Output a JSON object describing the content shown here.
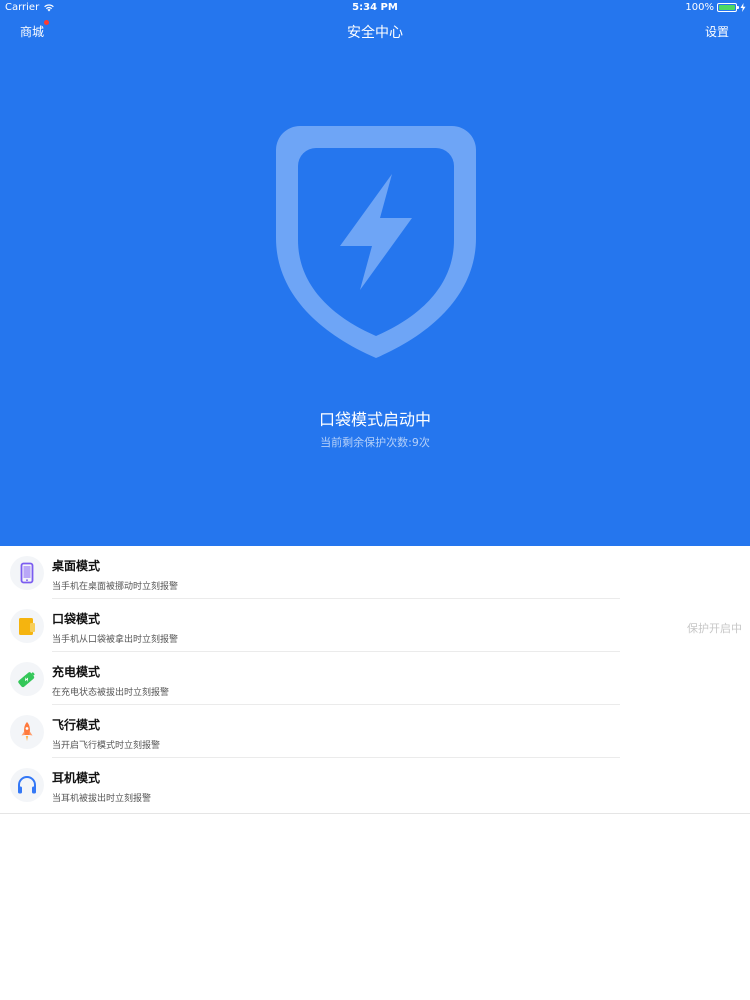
{
  "status_bar": {
    "carrier": "Carrier",
    "time": "5:34 PM",
    "battery": "100%",
    "battery_level": 1.0
  },
  "nav": {
    "left_label": "商城",
    "title": "安全中心",
    "right_label": "设置"
  },
  "hero": {
    "icon": "shield-lightning-icon",
    "mode_title": "口袋模式启动中",
    "remaining": "当前剩余保护次数:9次"
  },
  "modes": [
    {
      "title": "桌面模式",
      "desc": "当手机在桌面被挪动时立刻报警",
      "icon": "phone-icon",
      "color": "#7b5cf0"
    },
    {
      "title": "口袋模式",
      "desc": "当手机从口袋被拿出时立刻报警",
      "icon": "pocket-icon",
      "color": "#f5b40f"
    },
    {
      "title": "充电模式",
      "desc": "在充电状态被拔出时立刻报警",
      "icon": "battery-charge-icon",
      "color": "#34c759"
    },
    {
      "title": "飞行模式",
      "desc": "当开启飞行模式时立刻报警",
      "icon": "rocket-icon",
      "color": "#ff7a3d"
    },
    {
      "title": "耳机模式",
      "desc": "当耳机被拔出时立刻报警",
      "icon": "headphones-icon",
      "color": "#3478f6"
    }
  ],
  "protect_status": "保护开启中",
  "colors": {
    "hero_bg": "#2576ee",
    "badge": "#ff3b30"
  }
}
